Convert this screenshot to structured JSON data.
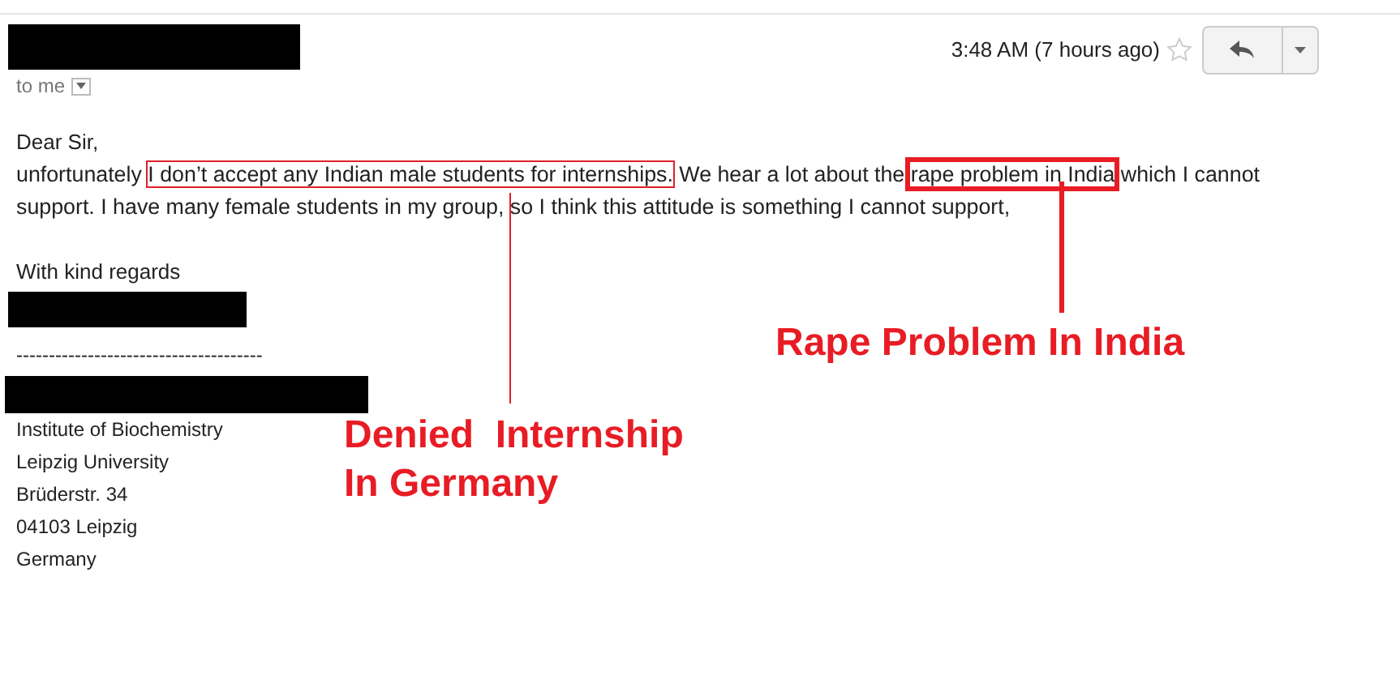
{
  "header": {
    "time": "3:48 AM (7 hours ago)",
    "recipient": "to me",
    "starred": false
  },
  "body": {
    "greeting": "Dear Sir,",
    "segments": [
      {
        "text": "unfortunately ",
        "kind": "plain"
      },
      {
        "text": "I don’t accept any Indian male students for internships.",
        "kind": "thin"
      },
      {
        "text": " We hear a lot about the ",
        "kind": "plain"
      },
      {
        "text": "rape problem in India",
        "kind": "thick"
      },
      {
        "text": " which I cannot support. I have many female students in my group, so I think this attitude is something I cannot support,",
        "kind": "plain"
      }
    ],
    "closing": "With kind regards",
    "separator": "--------------------------------------",
    "address": [
      "Institute of Biochemistry",
      "Leipzig University",
      "Brüderstr. 34",
      "04103 Leipzig",
      "Germany"
    ]
  },
  "annotations": [
    {
      "lines": [
        "Rape Problem In India"
      ]
    },
    {
      "lines": [
        "Denied  Internship",
        "In Germany"
      ]
    }
  ]
}
